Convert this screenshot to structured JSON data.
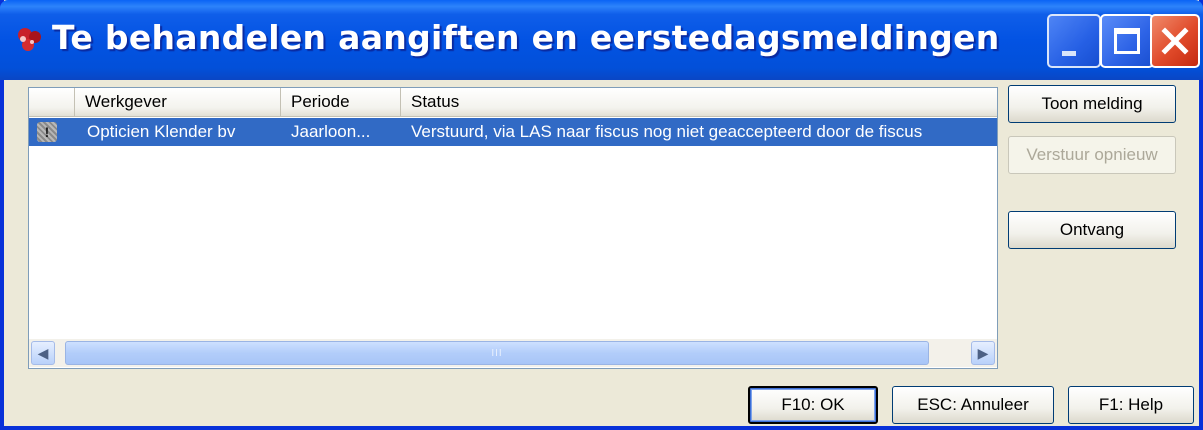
{
  "window": {
    "title": "Te behandelen aangiften en eerstedagsmeldingen"
  },
  "table": {
    "columns": [
      "",
      "Werkgever",
      "Periode",
      "Status"
    ],
    "rows": [
      {
        "icon": "warning-icon",
        "werkgever": "Opticien Klender bv",
        "periode": "Jaarloon...",
        "status": "Verstuurd, via LAS naar fiscus nog niet geaccepteerd door de fiscus",
        "selected": true
      }
    ],
    "scroll_thumb_grip": "III"
  },
  "side_buttons": {
    "toon_melding": "Toon melding",
    "verstuur_opnieuw": "Verstuur opnieuw",
    "ontvang": "Ontvang"
  },
  "footer_buttons": {
    "ok": "F10: OK",
    "annuleer": "ESC: Annuleer",
    "help": "F1: Help"
  },
  "colors": {
    "titlebar": "#0353e3",
    "selection": "#316ac5",
    "dialog_bg": "#ece9d8",
    "close_button": "#e04a2a"
  }
}
